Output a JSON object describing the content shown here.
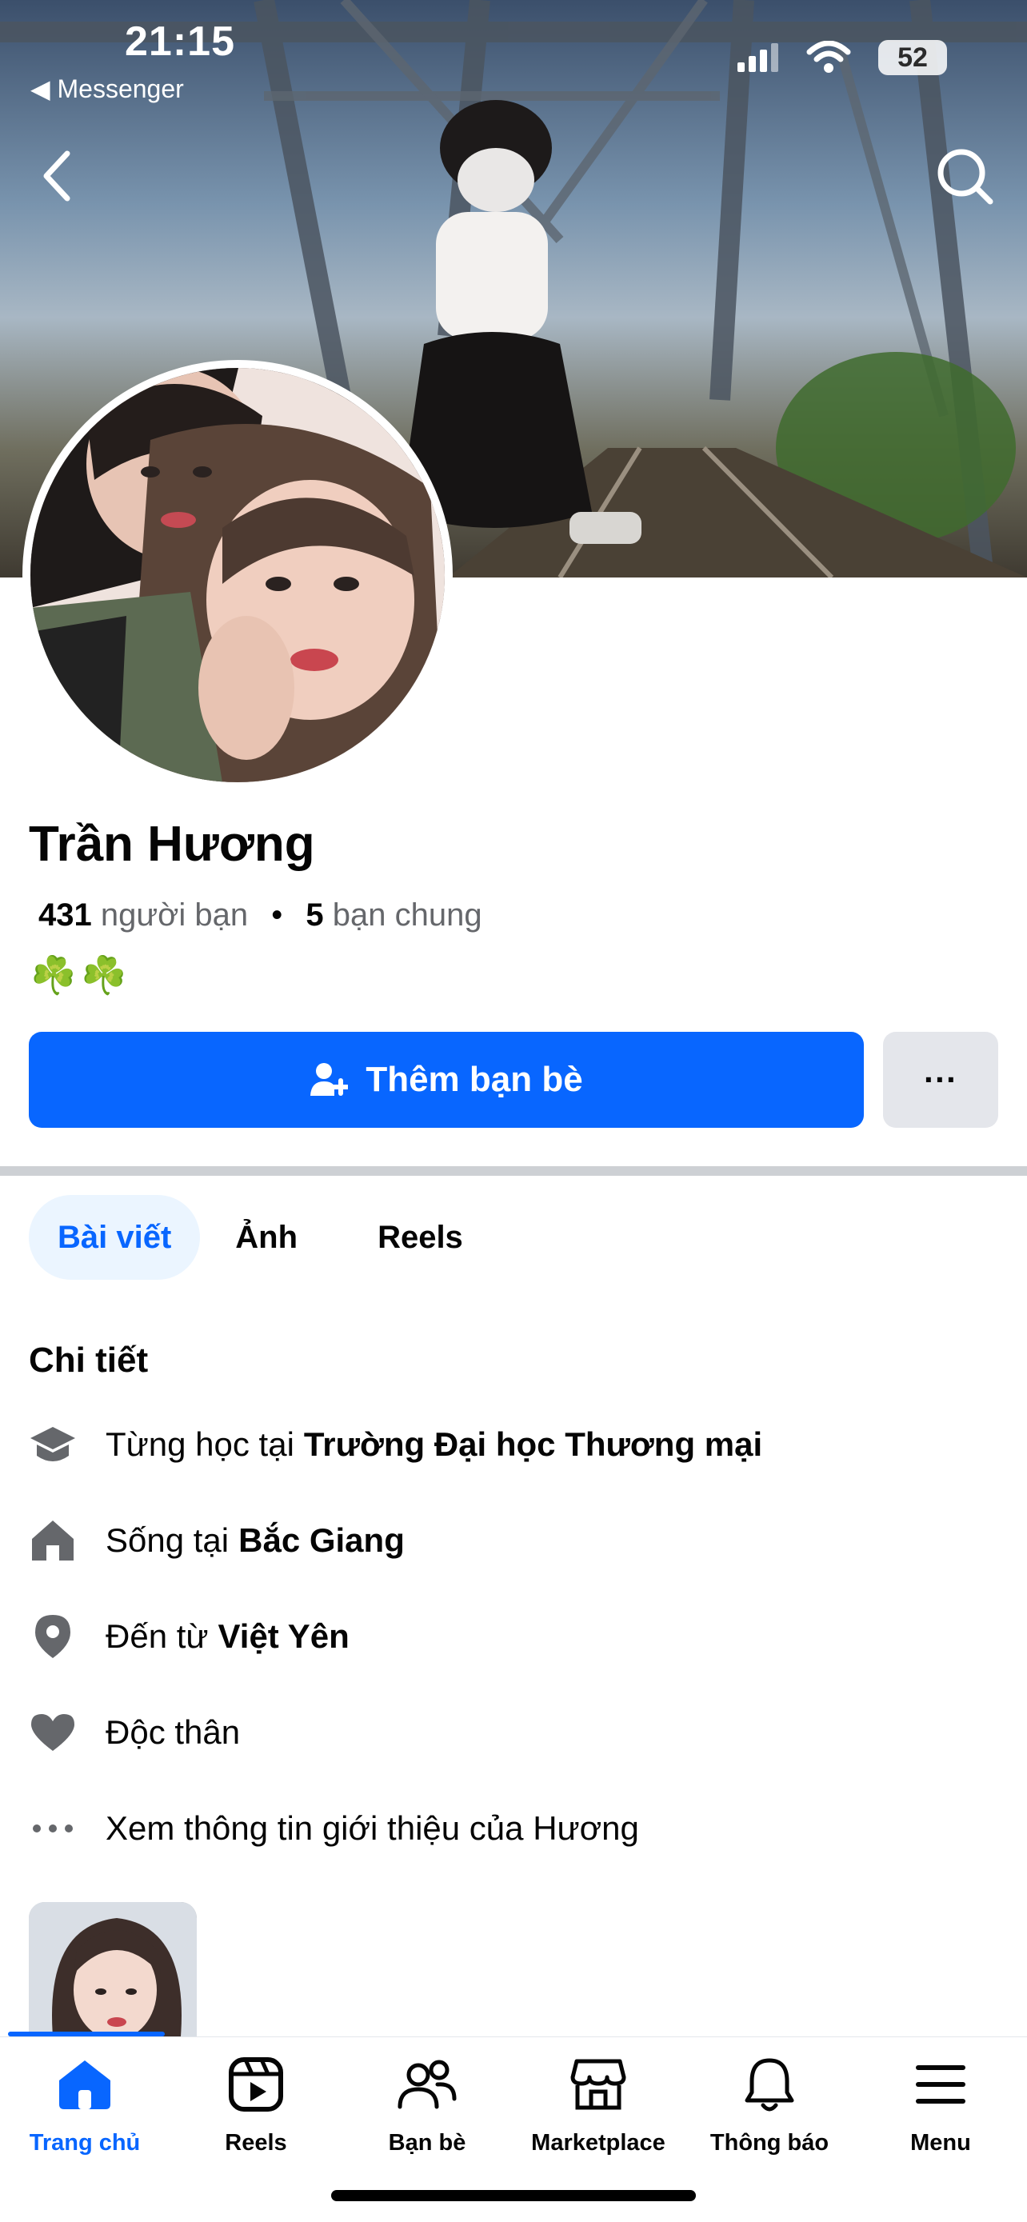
{
  "status_bar": {
    "time": "21:15",
    "back_app": "◀ Messenger",
    "battery": "52"
  },
  "profile": {
    "name": "Trần Hương",
    "friends_count": "431",
    "friends_label": "người bạn",
    "separator": "•",
    "mutual_count": "5",
    "mutual_label": "bạn chung",
    "emoji": "☘️☘️"
  },
  "actions": {
    "add_friend_label": "Thêm bạn bè",
    "more_label": "···"
  },
  "tabs": [
    {
      "label": "Bài viết",
      "active": true
    },
    {
      "label": "Ảnh",
      "active": false
    },
    {
      "label": "Reels",
      "active": false
    }
  ],
  "details": {
    "title": "Chi tiết",
    "items": [
      {
        "icon": "education-cap-icon",
        "prefix": "Từng học tại",
        "value": "Trường Đại học Thương mại"
      },
      {
        "icon": "home-icon",
        "prefix": "Sống tại",
        "value": "Bắc Giang"
      },
      {
        "icon": "location-pin-icon",
        "prefix": "Đến từ",
        "value": "Việt Yên"
      },
      {
        "icon": "heart-icon",
        "prefix": "Độc thân",
        "value": ""
      },
      {
        "icon": "more-dots-icon",
        "prefix": "Xem thông tin giới thiệu của Hương",
        "value": ""
      }
    ]
  },
  "bottom_nav": [
    {
      "label": "Trang chủ",
      "icon": "home-icon",
      "active": true
    },
    {
      "label": "Reels",
      "icon": "reels-icon",
      "active": false
    },
    {
      "label": "Bạn bè",
      "icon": "friends-icon",
      "active": false
    },
    {
      "label": "Marketplace",
      "icon": "marketplace-icon",
      "active": false
    },
    {
      "label": "Thông báo",
      "icon": "bell-icon",
      "active": false
    },
    {
      "label": "Menu",
      "icon": "menu-icon",
      "active": false
    }
  ],
  "colors": {
    "accent": "#0866ff",
    "tab_active_bg": "#ebf5ff",
    "secondary_text": "#65676b",
    "icon_gray": "#65676b"
  }
}
